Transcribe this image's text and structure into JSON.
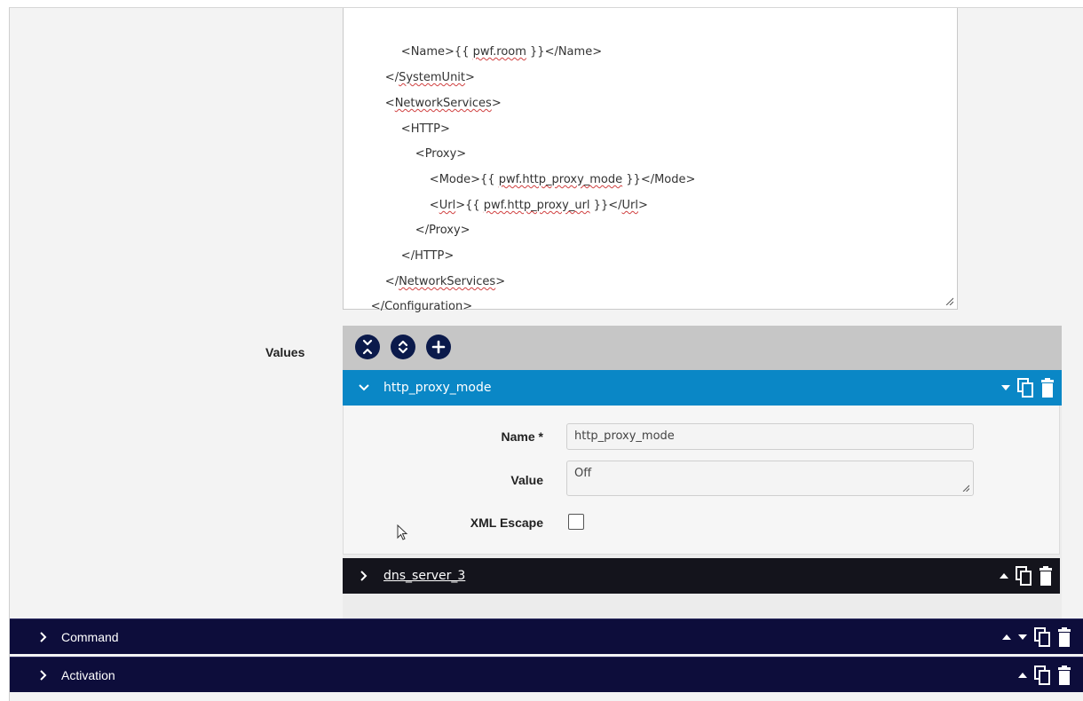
{
  "editor": {
    "lines": [
      {
        "text": "<Name>{{ ",
        "sq": "pwf.room",
        "rest": " }}</Name>"
      },
      {
        "text": "</",
        "sq": "SystemUnit",
        "rest": ">"
      },
      {
        "text": "<",
        "sq": "NetworkServices",
        "rest": ">"
      },
      {
        "text": "<HTTP>",
        "sq": "",
        "rest": ""
      },
      {
        "text": "<Proxy>",
        "sq": "",
        "rest": ""
      },
      {
        "text": "<Mode>{{ ",
        "sq": "pwf.http_proxy_mode",
        "rest": " }}</Mode>"
      },
      {
        "text": "<",
        "sq": "Url",
        "rest": ">{{ "
      },
      {
        "text": "</Proxy>",
        "sq": "",
        "rest": ""
      },
      {
        "text": "</HTTP>",
        "sq": "",
        "rest": ""
      },
      {
        "text": "</",
        "sq": "NetworkServices",
        "rest": ">"
      },
      {
        "text": "</Configuration>",
        "sq": "",
        "rest": ""
      }
    ],
    "url_line_tail": {
      "sq1": "pwf.http_proxy_url",
      "mid": " }}</",
      "sq2": "Url",
      "end": ">"
    }
  },
  "values": {
    "label": "Values",
    "toolbar_icons": [
      "collapse-all-icon",
      "expand-all-icon",
      "add-icon"
    ],
    "items": [
      {
        "title": "http_proxy_mode",
        "expanded": true,
        "fields": {
          "name_label": "Name *",
          "name_value": "http_proxy_mode",
          "value_label": "Value",
          "value_value": "Off",
          "xml_escape_label": "XML Escape",
          "xml_escape_checked": false
        }
      },
      {
        "title": "dns_server_3",
        "expanded": false
      }
    ]
  },
  "sections": [
    {
      "title": "Command"
    },
    {
      "title": "Activation"
    }
  ],
  "colors": {
    "accent_blue": "#0a87c6",
    "navy": "#0d0d3b",
    "dark_item": "#14141c"
  }
}
